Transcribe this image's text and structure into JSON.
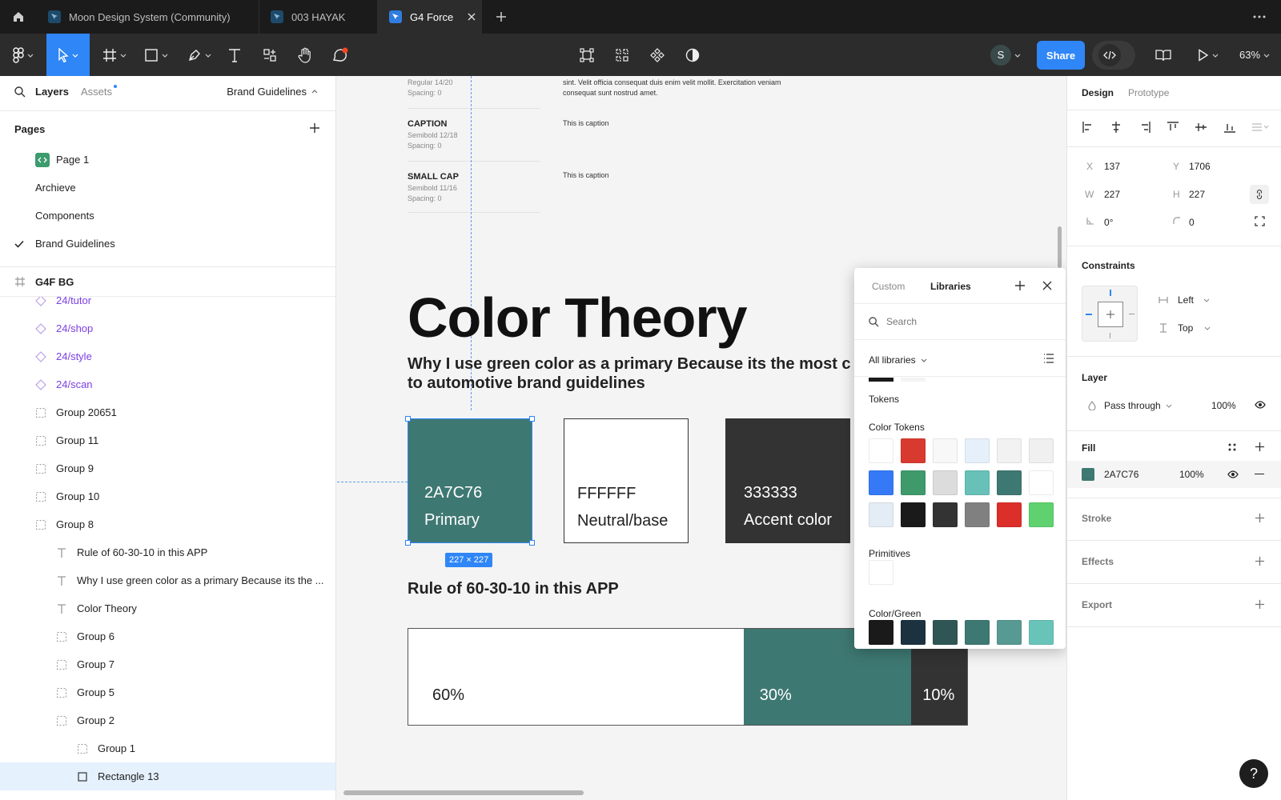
{
  "tabs": [
    {
      "label": "Moon Design System (Community)"
    },
    {
      "label": "003 HAYAK"
    },
    {
      "label": "G4 Force"
    }
  ],
  "toolbar": {
    "avatar_initial": "S",
    "share_label": "Share",
    "zoom": "63%"
  },
  "left_panel": {
    "tab_layers": "Layers",
    "tab_assets": "Assets",
    "current_page": "Brand Guidelines",
    "pages_title": "Pages",
    "pages": [
      {
        "label": "Page 1"
      },
      {
        "label": "Archieve"
      },
      {
        "label": "Components"
      },
      {
        "label": "Brand Guidelines"
      }
    ],
    "frame_name": "G4F BG",
    "layers": [
      {
        "label": "24/tutor"
      },
      {
        "label": "24/shop"
      },
      {
        "label": "24/style"
      },
      {
        "label": "24/scan"
      },
      {
        "label": "Group 20651"
      },
      {
        "label": "Group 11"
      },
      {
        "label": "Group 9"
      },
      {
        "label": "Group 10"
      },
      {
        "label": "Group 8"
      },
      {
        "label": "Rule of 60-30-10 in this APP"
      },
      {
        "label": "Why I use green color as a primary Because its the ..."
      },
      {
        "label": "Color Theory"
      },
      {
        "label": "Group 6"
      },
      {
        "label": "Group 7"
      },
      {
        "label": "Group 5"
      },
      {
        "label": "Group 2"
      },
      {
        "label": "Group 1"
      },
      {
        "label": "Rectangle 13"
      }
    ]
  },
  "canvas": {
    "typo_rows": [
      {
        "name": "",
        "spec": "Regular 14/20",
        "spacing": "Spacing: 0",
        "sample": "sint. Velit officia consequat duis enim velit mollit. Exercitation veniam",
        "sample2": "consequat sunt nostrud amet."
      },
      {
        "name": "CAPTION",
        "spec": "Semibold 12/18",
        "spacing": "Spacing: 0",
        "sample": "This is caption"
      },
      {
        "name": "SMALL CAP",
        "spec": "Semibold 11/16",
        "spacing": "Spacing: 0",
        "sample": "This is caption"
      }
    ],
    "title": "Color Theory",
    "subtitle_line1": "Why I use green color as a primary Because its the most c",
    "subtitle_line2": "to automotive brand guidelines",
    "cards": [
      {
        "hex": "2A7C76",
        "name": "Primary",
        "color": "#3e7872"
      },
      {
        "hex": "FFFFFF",
        "name": "Neutral/base",
        "color": "#ffffff"
      },
      {
        "hex": "333333",
        "name": "Accent color",
        "color": "#333333"
      }
    ],
    "size_badge": "227 × 227",
    "rule_title": "Rule of 60-30-10 in this APP",
    "rule_bar": [
      {
        "label": "60%",
        "share": 60,
        "color": "#ffffff"
      },
      {
        "label": "30%",
        "share": 30,
        "color": "#3e7872"
      },
      {
        "label": "10%",
        "share": 10,
        "color": "#333333"
      }
    ]
  },
  "picker": {
    "tab_custom": "Custom",
    "tab_libraries": "Libraries",
    "search_placeholder": "Search",
    "filter": "All libraries",
    "section_tokens": "Tokens",
    "section_color_tokens": "Color Tokens",
    "color_tokens": [
      "#ffffff",
      "#d93a2f",
      "#f8f8f8",
      "#e6f0fb",
      "#f2f2f2",
      "#f0f0f0",
      "#3579f6",
      "#3e9a6b",
      "#dcdcdc",
      "#67c1b8",
      "#3e7872",
      "#ffffff",
      "#e4ecf5",
      "#1a1a1a",
      "#333333",
      "#808080",
      "#dc2f2a",
      "#5fd16f"
    ],
    "section_primitives": "Primitives",
    "primitives": [
      "#ffffff"
    ],
    "section_color_green": "Color/Green",
    "green": [
      "#1a1a1a",
      "#1d3240",
      "#2f5655",
      "#3e7872",
      "#569a93",
      "#68c4b9"
    ]
  },
  "right_panel": {
    "tab_design": "Design",
    "tab_prototype": "Prototype",
    "x_label": "X",
    "x": "137",
    "y_label": "Y",
    "y": "1706",
    "w_label": "W",
    "w": "227",
    "h_label": "H",
    "h": "227",
    "rotation": "0°",
    "radius": "0",
    "constraints_title": "Constraints",
    "constraint_h": "Left",
    "constraint_v": "Top",
    "layer_title": "Layer",
    "blend": "Pass through",
    "layer_opacity": "100%",
    "fill_title": "Fill",
    "fill_hex": "2A7C76",
    "fill_opacity": "100%",
    "fill_color": "#3e7872",
    "stroke_title": "Stroke",
    "effects_title": "Effects",
    "export_title": "Export"
  },
  "help_label": "?"
}
